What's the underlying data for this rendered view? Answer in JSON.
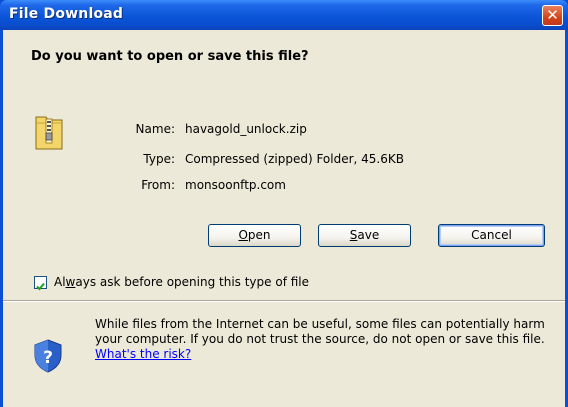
{
  "dialog": {
    "title": "File Download",
    "close_glyph": "✕",
    "heading": "Do you want to open or save this file?"
  },
  "file_info": {
    "name_label": "Name:",
    "name_value": "havagold_unlock.zip",
    "type_label": "Type:",
    "type_value": "Compressed (zipped) Folder, 45.6KB",
    "from_label": "From:",
    "from_value": "monsoonftp.com",
    "icon": "zip-folder-icon"
  },
  "buttons": {
    "open": {
      "accel": "O",
      "rest": "pen"
    },
    "save": {
      "accel": "S",
      "rest": "ave"
    },
    "cancel": "Cancel"
  },
  "checkbox": {
    "checked": true,
    "before": "Al",
    "accel": "w",
    "after": "ays ask before opening this type of file"
  },
  "warning": {
    "text": "While files from the Internet can be useful, some files can potentially harm your computer. If you do not trust the source, do not open or save this file.",
    "link": "What's the risk?",
    "icon": "shield-question-icon"
  },
  "colors": {
    "titlebar": "#0a4fd6",
    "dialog_bg": "#ece9d8",
    "close_button": "#d4451b",
    "checkmark": "#21a121",
    "link": "#0000ff"
  }
}
